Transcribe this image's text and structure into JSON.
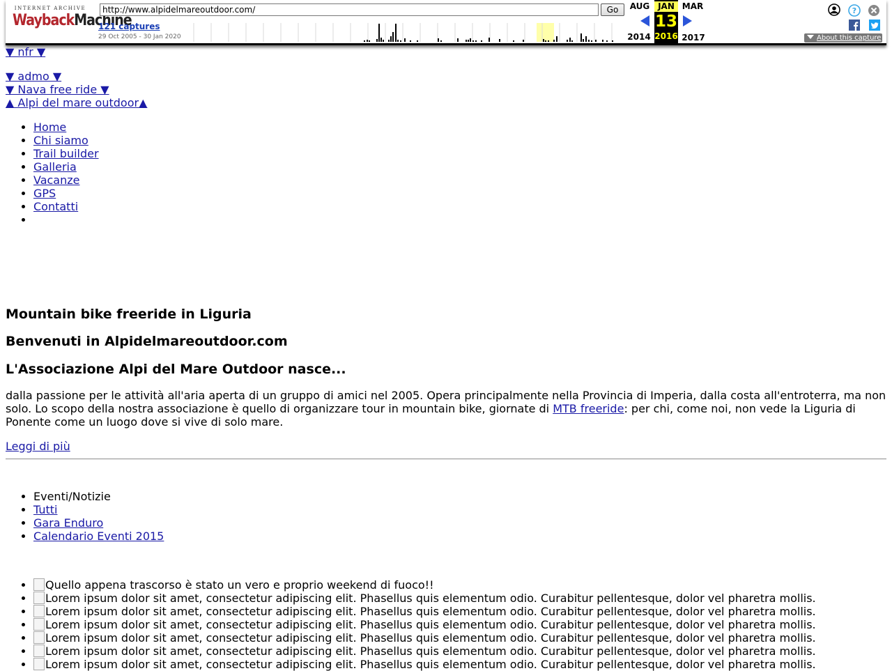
{
  "wayback": {
    "logo_top": "INTERNET ARCHIVE",
    "logo_main_1": "Wayback",
    "logo_main_2": "Machine",
    "url": "http://www.alpidelmareoutdoor.com/",
    "go_label": "Go",
    "captures_label": "121 captures",
    "date_range": "29 Oct 2005 - 30 Jan 2020",
    "prev_month": "AUG",
    "prev_year": "2014",
    "cur_month": "JAN",
    "cur_day": "13",
    "cur_year": "2016",
    "next_month": "MAR",
    "next_year": "2017",
    "about_label": "About this capture",
    "icons": [
      "user-icon",
      "help-icon",
      "close-icon",
      "facebook-icon",
      "twitter-icon"
    ],
    "colors": {
      "accent": "#2b55d9",
      "highlight": "#ffff00",
      "brand_red": "#b3262d"
    }
  },
  "page": {
    "toggles": [
      "▼ nfr ▼",
      "▼ admo ▼",
      "▼ Nava free ride ▼",
      "▲ Alpi del mare outdoor▲"
    ],
    "nav": [
      "Home",
      "Chi siamo",
      "Trail builder",
      "Galleria",
      "Vacanze",
      "GPS",
      "Contatti"
    ],
    "heading_1": "Mountain bike freeride in Liguria",
    "heading_2": "Benvenuti in Alpidelmareoutdoor.com",
    "heading_3": "L'Associazione Alpi del Mare Outdoor nasce...",
    "intro_before": "dalla passione per le attività all'aria aperta di un gruppo di amici nel 2005. Opera principalmente nella Provincia di Imperia, dalla costa all'entroterra, ma non solo. Lo scopo della nostra associazione è quello di organizzare tour in mountain bike, giornate di ",
    "intro_link": "MTB freeride",
    "intro_after": ": per chi, come noi, non vede la Liguria di Ponente come un luogo dove si vive di solo mare.",
    "read_more": "Leggi di più",
    "events_title": "Eventi/Notizie",
    "events_links": [
      "Tutti",
      "Gara Enduro",
      "Calendario Eventi 2015"
    ],
    "news": [
      "Quello appena trascorso è stato un vero e proprio weekend di fuoco!!",
      "Lorem ipsum dolor sit amet, consectetur adipiscing elit. Phasellus quis elementum odio. Curabitur pellentesque, dolor vel pharetra mollis.",
      "Lorem ipsum dolor sit amet, consectetur adipiscing elit. Phasellus quis elementum odio. Curabitur pellentesque, dolor vel pharetra mollis.",
      "Lorem ipsum dolor sit amet, consectetur adipiscing elit. Phasellus quis elementum odio. Curabitur pellentesque, dolor vel pharetra mollis.",
      "Lorem ipsum dolor sit amet, consectetur adipiscing elit. Phasellus quis elementum odio. Curabitur pellentesque, dolor vel pharetra mollis.",
      "Lorem ipsum dolor sit amet, consectetur adipiscing elit. Phasellus quis elementum odio. Curabitur pellentesque, dolor vel pharetra mollis.",
      "Lorem ipsum dolor sit amet, consectetur adipiscing elit. Phasellus quis elementum odio. Curabitur pellentesque, dolor vel pharetra mollis."
    ]
  }
}
